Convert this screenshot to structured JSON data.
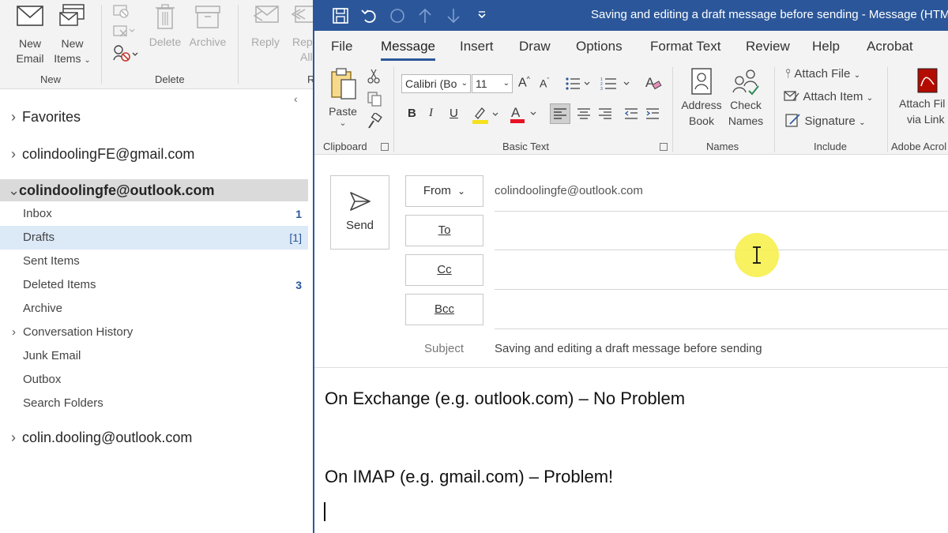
{
  "main_ribbon": {
    "new_email": "New\nEmail",
    "new_email_l1": "New",
    "new_email_l2": "Email",
    "new_items_l1": "New",
    "new_items_l2": "Items",
    "group_new": "New",
    "delete": "Delete",
    "archive": "Archive",
    "group_delete": "Delete",
    "reply": "Reply",
    "reply_all_l1": "Rep",
    "reply_all_l2": "All",
    "group_respond": "R"
  },
  "nav": {
    "favorites": "Favorites",
    "account_gmail": "colindoolingFE@gmail.com",
    "account_outlook": "colindoolingfe@outlook.com",
    "account_other": "colin.dooling@outlook.com",
    "folders": [
      {
        "name": "Inbox",
        "count": "1"
      },
      {
        "name": "Drafts",
        "count": "[1]"
      },
      {
        "name": "Sent Items",
        "count": ""
      },
      {
        "name": "Deleted Items",
        "count": "3"
      },
      {
        "name": "Archive",
        "count": ""
      },
      {
        "name": "Conversation History",
        "count": ""
      },
      {
        "name": "Junk Email",
        "count": ""
      },
      {
        "name": "Outbox",
        "count": ""
      },
      {
        "name": "Search Folders",
        "count": ""
      }
    ]
  },
  "compose": {
    "title": "Saving and editing a draft message before sending  -  Message (HTML)",
    "tabs": [
      "File",
      "Message",
      "Insert",
      "Draw",
      "Options",
      "Format Text",
      "Review",
      "Help",
      "Acrobat"
    ],
    "ribbon": {
      "paste": "Paste",
      "group_clipboard": "Clipboard",
      "font_name": "Calibri (Bo",
      "font_size": "11",
      "bold": "B",
      "italic": "I",
      "underline": "U",
      "group_basic_text": "Basic Text",
      "address_l1": "Address",
      "address_l2": "Book",
      "check_l1": "Check",
      "check_l2": "Names",
      "group_names": "Names",
      "attach_file": "Attach File",
      "attach_item": "Attach Item",
      "signature": "Signature",
      "group_include": "Include",
      "attach_link_l1": "Attach Fil",
      "attach_link_l2": "via Link",
      "group_adobe": "Adobe Acrol"
    },
    "send": "Send",
    "from_btn": "From",
    "to_btn": "To",
    "cc_btn": "Cc",
    "bcc_btn": "Bcc",
    "from_value": "colindoolingfe@outlook.com",
    "subject_label": "Subject",
    "subject_value": "Saving and editing a draft message before sending",
    "body_line1": "On Exchange (e.g. outlook.com) – No Problem",
    "body_line2": "On IMAP (e.g. gmail.com) – Problem!"
  },
  "colors": {
    "brand_blue": "#2b579a",
    "ribbon_bg": "#f3f3f3",
    "selected_folder": "#dce9f7",
    "cursor_highlight": "#f7ef4f"
  }
}
